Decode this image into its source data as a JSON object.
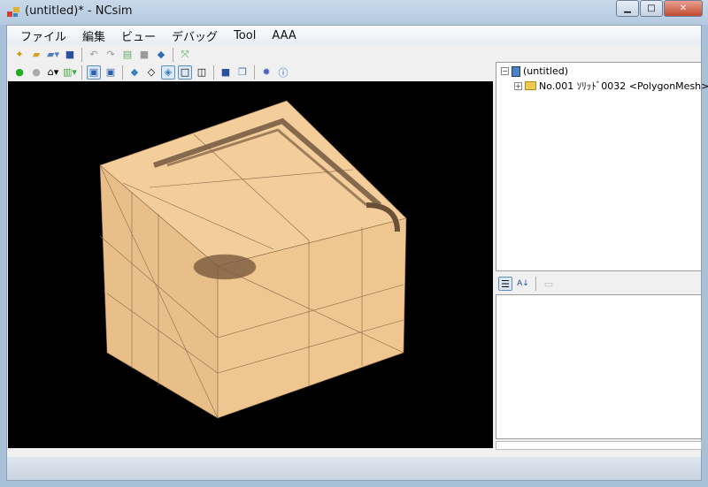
{
  "window": {
    "title": "(untitled)* - NCsim",
    "minimize": "▁",
    "maximize": "□",
    "close": "✕"
  },
  "menu": [
    "ファイル",
    "編集",
    "ビュー",
    "デバッグ",
    "Tool",
    "AAA"
  ],
  "toolbar1": [
    "new-icon",
    "open-icon",
    "open-dropdown-icon",
    "save-icon",
    "undo-icon",
    "redo-icon",
    "script-icon",
    "stop-icon",
    "python-icon",
    "fit-icon"
  ],
  "toolbar2": [
    "back-icon",
    "forward-icon",
    "home-icon",
    "view-dropdown-icon",
    "box-solid-icon",
    "box-solid2-icon",
    "shaded-icon",
    "wireframe-icon",
    "shaded-wire-icon",
    "front-ortho-icon",
    "persp-icon",
    "save-image-icon",
    "copy-icon",
    "settings-icon",
    "info-icon"
  ],
  "tree": {
    "root": "(untitled)",
    "child": "No.001 ｿﾘｯﾄﾞ0032 <PolygonMesh>"
  },
  "colors": {
    "mesh": "#f2c993",
    "viewport": "#000000"
  }
}
